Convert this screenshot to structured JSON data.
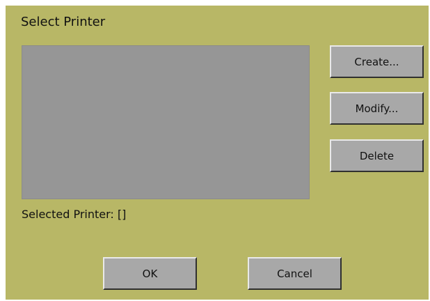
{
  "dialog": {
    "title": "Select Printer"
  },
  "printer_list": {
    "items": []
  },
  "actions": {
    "create_label": "Create...",
    "modify_label": "Modify...",
    "delete_label": "Delete"
  },
  "status": {
    "selected_label": "Selected Printer:",
    "selected_value": "[]"
  },
  "footer": {
    "ok_label": "OK",
    "cancel_label": "Cancel"
  },
  "colors": {
    "dialog_background": "#b8b766",
    "list_background": "#969696",
    "button_face": "#a8a8a8"
  }
}
